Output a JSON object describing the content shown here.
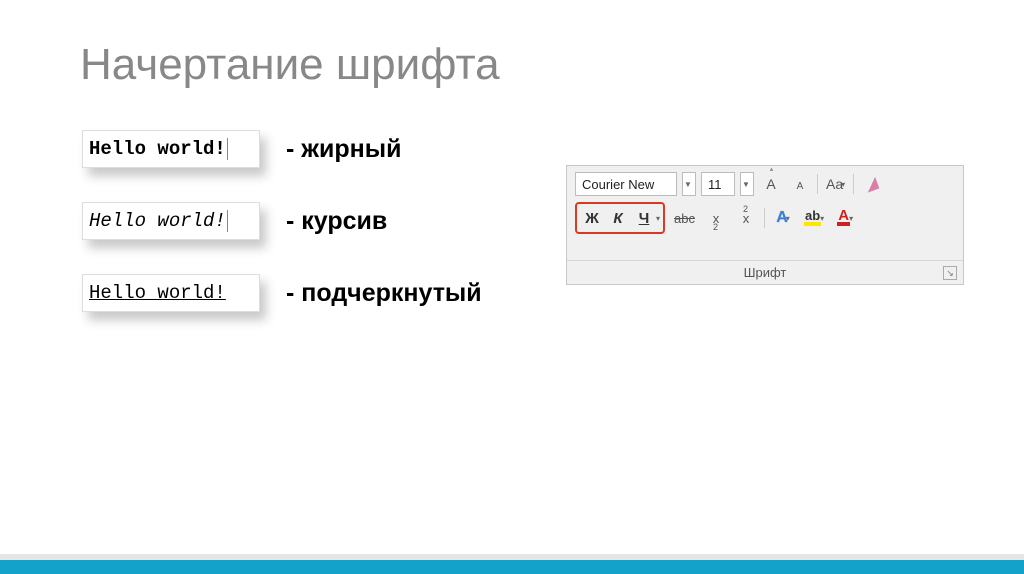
{
  "title": "Начертание шрифта",
  "examples": [
    {
      "text": "Hello world!",
      "desc": "- жирный"
    },
    {
      "text": "Hello world!",
      "desc": "- курсив"
    },
    {
      "text": "Hello world!",
      "desc": "- подчеркнутый"
    }
  ],
  "ribbon": {
    "font_name": "Courier New",
    "font_size": "11",
    "group_label": "Шрифт",
    "bold_label": "Ж",
    "italic_label": "К",
    "underline_label": "Ч",
    "grow_label": "A",
    "shrink_label": "A",
    "case_label": "Aa",
    "strike_label": "abc",
    "sub_label": "x",
    "sup_label": "x",
    "effects_label": "A",
    "highlight_label": "ab",
    "fontcolor_label": "A"
  }
}
